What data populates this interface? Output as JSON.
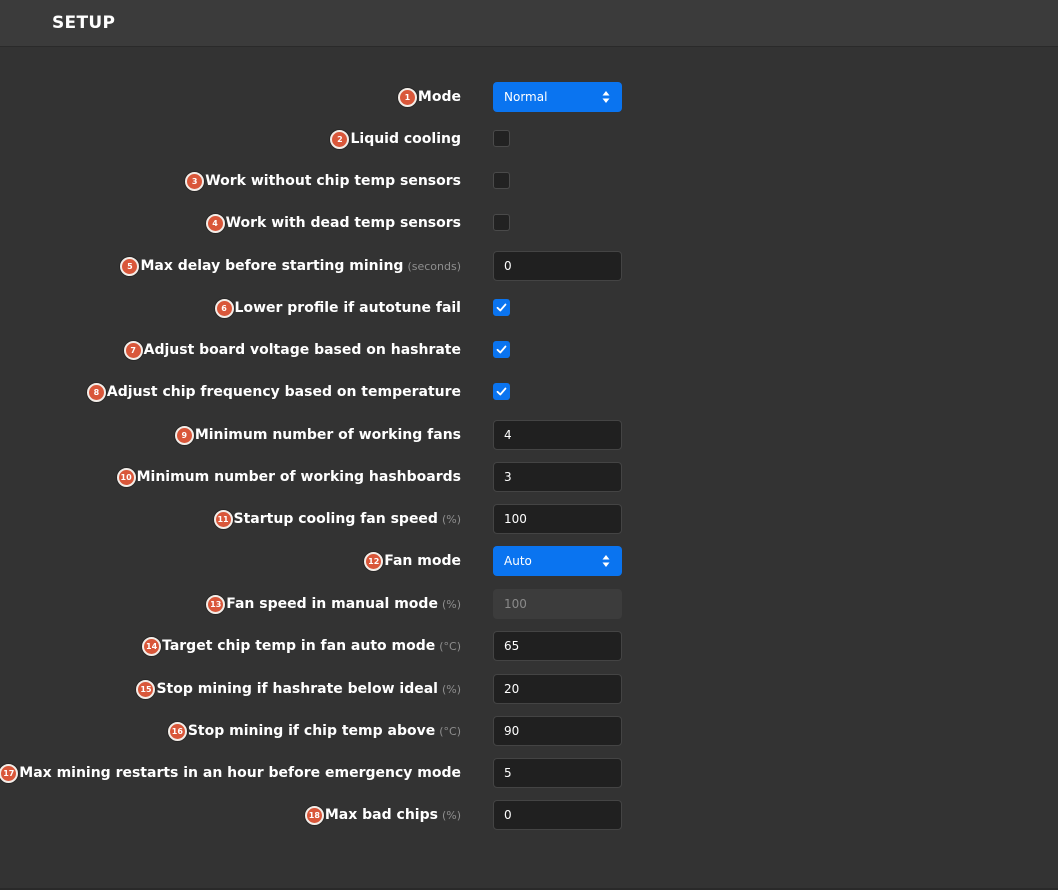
{
  "header": {
    "title": "SETUP"
  },
  "colors": {
    "accent": "#0a74f0",
    "badge": "#d9573a",
    "background": "#333333"
  },
  "rows": [
    {
      "num": "1",
      "label": "Mode",
      "unit": "",
      "type": "select",
      "value": "Normal"
    },
    {
      "num": "2",
      "label": "Liquid cooling",
      "unit": "",
      "type": "checkbox",
      "checked": false
    },
    {
      "num": "3",
      "label": "Work without chip temp sensors",
      "unit": "",
      "type": "checkbox",
      "checked": false
    },
    {
      "num": "4",
      "label": "Work with dead temp sensors",
      "unit": "",
      "type": "checkbox",
      "checked": false
    },
    {
      "num": "5",
      "label": "Max delay before starting mining",
      "unit": "(seconds)",
      "type": "input",
      "value": "0"
    },
    {
      "num": "6",
      "label": "Lower profile if autotune fail",
      "unit": "",
      "type": "checkbox",
      "checked": true
    },
    {
      "num": "7",
      "label": "Adjust board voltage based on hashrate",
      "unit": "",
      "type": "checkbox",
      "checked": true
    },
    {
      "num": "8",
      "label": "Adjust chip frequency based on temperature",
      "unit": "",
      "type": "checkbox",
      "checked": true
    },
    {
      "num": "9",
      "label": "Minimum number of working fans",
      "unit": "",
      "type": "input",
      "value": "4"
    },
    {
      "num": "10",
      "label": "Minimum number of working hashboards",
      "unit": "",
      "type": "input",
      "value": "3"
    },
    {
      "num": "11",
      "label": "Startup cooling fan speed",
      "unit": "(%)",
      "type": "input",
      "value": "100"
    },
    {
      "num": "12",
      "label": "Fan mode",
      "unit": "",
      "type": "select",
      "value": "Auto"
    },
    {
      "num": "13",
      "label": "Fan speed in manual mode",
      "unit": "(%)",
      "type": "input-disabled",
      "value": "100"
    },
    {
      "num": "14",
      "label": "Target chip temp in fan auto mode",
      "unit": "(°C)",
      "type": "input",
      "value": "65"
    },
    {
      "num": "15",
      "label": "Stop mining if hashrate below ideal",
      "unit": "(%)",
      "type": "input",
      "value": "20"
    },
    {
      "num": "16",
      "label": "Stop mining if chip temp above",
      "unit": "(°C)",
      "type": "input",
      "value": "90"
    },
    {
      "num": "17",
      "label": "Max mining restarts in an hour before emergency mode",
      "unit": "",
      "type": "input",
      "value": "5"
    },
    {
      "num": "18",
      "label": "Max bad chips",
      "unit": "(%)",
      "type": "input",
      "value": "0"
    }
  ]
}
